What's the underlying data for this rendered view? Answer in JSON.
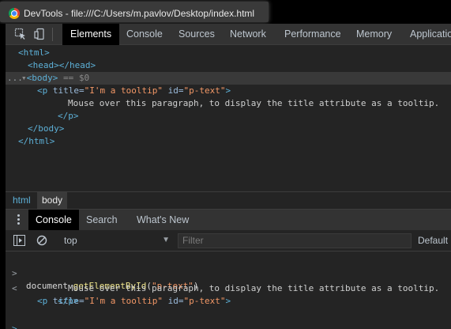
{
  "window": {
    "title": "DevTools - file:///C:/Users/m.pavlov/Desktop/index.html"
  },
  "tabs": [
    {
      "label": "Elements",
      "active": true
    },
    {
      "label": "Console",
      "active": false
    },
    {
      "label": "Sources",
      "active": false
    },
    {
      "label": "Network",
      "active": false
    },
    {
      "label": "Performance",
      "active": false
    },
    {
      "label": "Memory",
      "active": false
    },
    {
      "label": "Applicatio",
      "active": false
    }
  ],
  "elements": {
    "html_open": "<html>",
    "head_open": "<head>",
    "head_close": "</head>",
    "body_open": "<body>",
    "selected_marker": "== $0",
    "p_tag_open": "<p ",
    "attr_title_name": "title",
    "attr_title_value": "\"I'm a tooltip\"",
    "attr_id_name": "id",
    "attr_id_value": "\"p-text\"",
    "tag_close_bracket": ">",
    "p_text": "Mouse over this paragraph, to display the title attribute as a tooltip.",
    "p_close": "</p>",
    "body_close": "</body>",
    "html_close": "</html>",
    "ellipsis": "..."
  },
  "breadcrumbs": [
    {
      "label": "html"
    },
    {
      "label": "body"
    }
  ],
  "drawer": {
    "tabs": [
      {
        "label": "Console",
        "active": true
      },
      {
        "label": "Search",
        "active": false
      },
      {
        "label": "What's New",
        "active": false
      }
    ]
  },
  "console_toolbar": {
    "context": "top",
    "filter_placeholder": "Filter",
    "levels": "Default"
  },
  "console": {
    "input_prompt": ">",
    "output_prompt": "<",
    "input_obj": "document.",
    "input_method": "getElementById",
    "input_open": "(",
    "input_arg": "\"p-text\"",
    "input_close": ")",
    "next_prompt": ">"
  },
  "colors": {
    "tag": "#5db0d7",
    "attr_value": "#f29766",
    "panel_bg": "#242424",
    "active_tab_bg": "#000000"
  }
}
